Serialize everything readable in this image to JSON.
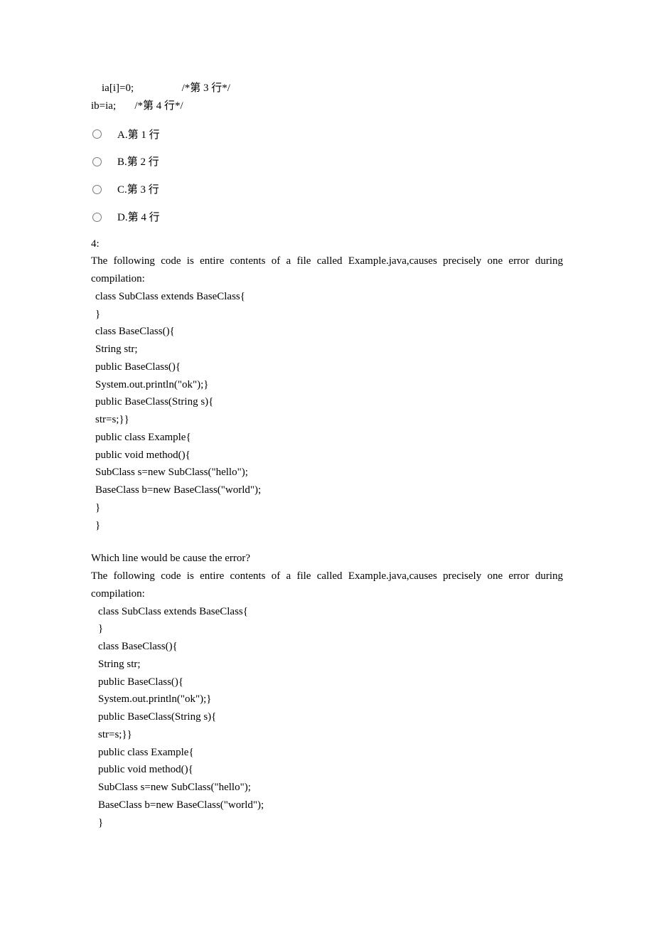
{
  "top_code": {
    "line1": "    ia[i]=0;                  /*第 3 行*/",
    "line2": "ib=ia;       /*第 4 行*/"
  },
  "options": {
    "a": "A.第 1 行",
    "b": "B.第 2 行",
    "c": "C.第 3 行",
    "d": "D.第 4 行"
  },
  "qnum": "4:",
  "stem1": "The following code is entire contents of a file called Example.java,causes precisely one error during compilation:",
  "code1": {
    "l1": "class SubClass extends BaseClass{",
    "l2": "}",
    "l3": "class BaseClass(){",
    "l4": "String str;",
    "l5": "public BaseClass(){",
    "l6": "System.out.println(\"ok\");}",
    "l7": "public BaseClass(String s){",
    "l8": "str=s;}}",
    "l9": "public class Example{",
    "l10": "public void method(){",
    "l11": "SubClass s=new SubClass(\"hello\");",
    "l12": "BaseClass b=new BaseClass(\"world\");",
    "l13": "}",
    "l14": "}"
  },
  "question_line": "Which line would be cause the error?",
  "stem2": "The following code is entire contents of a file called Example.java,causes precisely one error during compilation:",
  "code2": {
    "l1": "class SubClass extends BaseClass{",
    "l2": "}",
    "l3": "class BaseClass(){",
    "l4": "String str;",
    "l5": "public BaseClass(){",
    "l6": "System.out.println(\"ok\");}",
    "l7": "public BaseClass(String s){",
    "l8": "str=s;}}",
    "l9": "public class Example{",
    "l10": "public void method(){",
    "l11": "SubClass s=new SubClass(\"hello\");",
    "l12": "BaseClass b=new BaseClass(\"world\");",
    "l13": "}"
  }
}
